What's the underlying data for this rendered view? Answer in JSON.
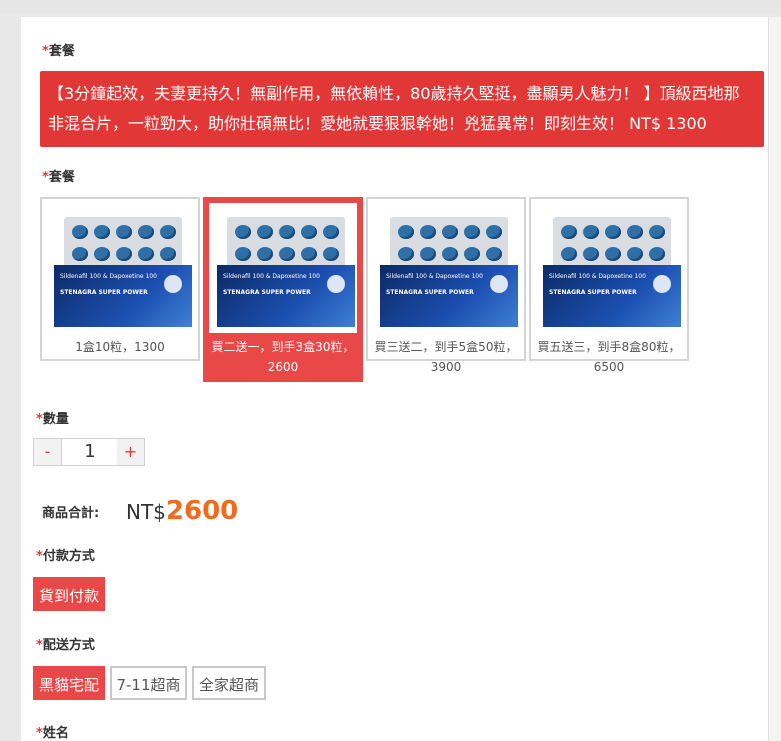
{
  "package_label": "套餐",
  "banner_text": "【3分鐘起效，夫妻更持久！無副作用，無依賴性，80歲持久堅挺，盡顯男人魅力！ 】頂級西地那非混合片，一粒勁大，助你壯碩無比！愛她就要狠狠幹她！兇猛異常！即刻生效！ NT$ 1300",
  "package_label_2": "套餐",
  "options": [
    {
      "caption": "1盒10粒，1300",
      "selected": false,
      "product_line1": "Sildenafil 100 & Dapoxetine 100",
      "product_line2": "STENAGRA SUPER POWER"
    },
    {
      "caption": "買二送一，到手3盒30粒，2600",
      "selected": true,
      "product_line1": "Sildenafil 100 & Dapoxetine 100",
      "product_line2": "STENAGRA SUPER POWER"
    },
    {
      "caption": "買三送二，到手5盒50粒，3900",
      "selected": false,
      "product_line1": "Sildenafil 100 & Dapoxetine 100",
      "product_line2": "STENAGRA SUPER POWER"
    },
    {
      "caption": "買五送三，到手8盒80粒，6500",
      "selected": false,
      "product_line1": "Sildenafil 100 & Dapoxetine 100",
      "product_line2": "STENAGRA SUPER POWER"
    }
  ],
  "quantity": {
    "label": "數量",
    "minus": "-",
    "value": "1",
    "plus": "+"
  },
  "total": {
    "label": "商品合計:",
    "currency": "NT$",
    "amount": "2600"
  },
  "payment": {
    "label": "付款方式",
    "options": [
      "貨到付款"
    ]
  },
  "shipping": {
    "label": "配送方式",
    "options": [
      "黑貓宅配",
      "7-11超商",
      "全家超商"
    ]
  },
  "name_label": "姓名",
  "colors": {
    "accent": "#e84848",
    "total_amount": "#f26b1d"
  }
}
